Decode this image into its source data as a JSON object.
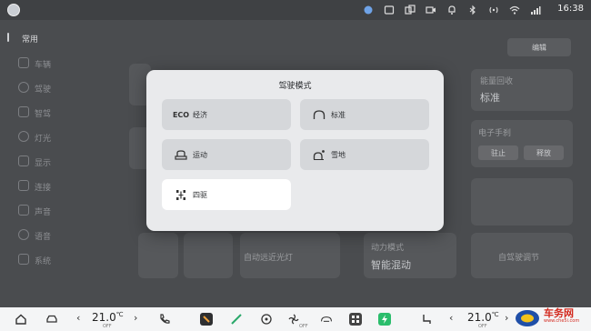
{
  "status_bar": {
    "time": "16:38",
    "icons": [
      "location-icon",
      "camera-frame-icon",
      "screen-mirror-icon",
      "video-icon",
      "bell-icon",
      "bluetooth-icon",
      "hotspot-icon",
      "wifi-icon",
      "signal-icon"
    ]
  },
  "sidebar": {
    "items": [
      {
        "label": "常用",
        "icon": "star-icon"
      },
      {
        "label": "车辆",
        "icon": "car-icon"
      },
      {
        "label": "驾驶",
        "icon": "steering-icon"
      },
      {
        "label": "智驾",
        "icon": "assist-icon"
      },
      {
        "label": "灯光",
        "icon": "light-icon"
      },
      {
        "label": "显示",
        "icon": "display-icon"
      },
      {
        "label": "连接",
        "icon": "link-icon"
      },
      {
        "label": "声音",
        "icon": "sound-icon"
      },
      {
        "label": "语音",
        "icon": "voice-icon"
      },
      {
        "label": "系统",
        "icon": "system-icon"
      }
    ]
  },
  "background": {
    "edit_label": "编辑",
    "energy_label": "能量回收",
    "energy_value": "标准",
    "parking_label": "电子手刹",
    "parking_options": [
      "驻止",
      "释放"
    ],
    "auto_light": "自动远近光灯",
    "power_label": "动力模式",
    "power_value": "智能混动",
    "feature_tail": "自驾驶调节"
  },
  "modal": {
    "title": "驾驶模式",
    "options": [
      {
        "label": "经济",
        "icon_text": "ECO",
        "icon": "eco-icon",
        "selected": false
      },
      {
        "label": "标准",
        "icon": "standard-mode-icon",
        "selected": false
      },
      {
        "label": "运动",
        "icon": "sport-mode-icon",
        "selected": false
      },
      {
        "label": "雪地",
        "icon": "snow-mode-icon",
        "selected": false
      },
      {
        "label": "四驱",
        "icon": "awd-icon",
        "selected": true
      }
    ]
  },
  "bottom_bar": {
    "left_temp": "21.0",
    "left_temp_unit": "℃",
    "left_sub": "OFF",
    "right_temp": "21.0",
    "right_temp_unit": "℃",
    "right_sub": "OFF",
    "fan_sub": "OFF",
    "icons": [
      "home-icon",
      "car-icon",
      "phone-icon",
      "app-icon",
      "navigation-icon",
      "steering-wheel-icon",
      "fan-icon",
      "recirculation-icon",
      "grid-icon",
      "charge-icon",
      "seat-heat-icon"
    ]
  },
  "watermark": {
    "name": "车务网",
    "url": "www.che5i.com"
  },
  "colors": {
    "modal_bg": "#e9eaec",
    "option_bg": "#d5d7da",
    "option_selected": "#ffffff",
    "page_bg": "#4a4c4f"
  }
}
